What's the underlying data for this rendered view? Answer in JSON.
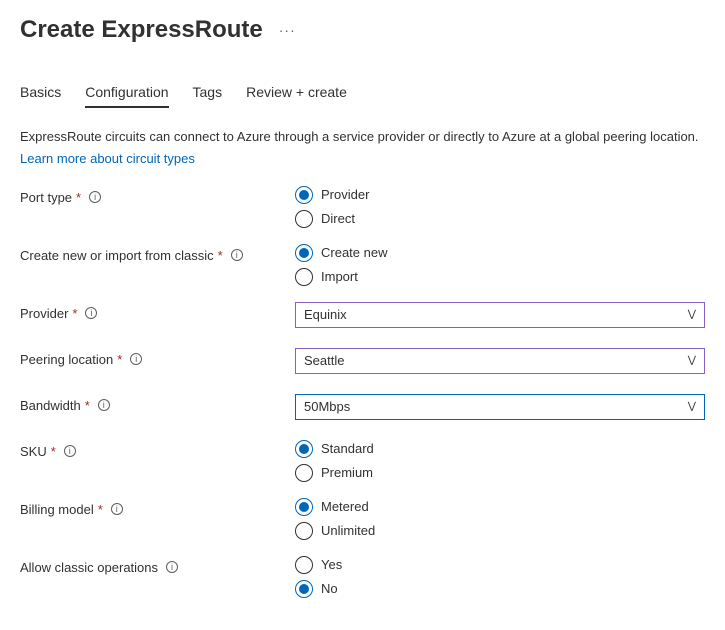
{
  "header": {
    "title": "Create ExpressRoute",
    "ellipsis": "···"
  },
  "tabs": {
    "items": [
      {
        "label": "Basics"
      },
      {
        "label": "Configuration"
      },
      {
        "label": "Tags"
      },
      {
        "label": "Review + create"
      }
    ],
    "activeIndex": 1
  },
  "intro": {
    "text": "ExpressRoute circuits can connect to Azure through a service provider or directly to Azure at a global peering location.",
    "link": "Learn more about circuit types"
  },
  "fields": {
    "portType": {
      "label": "Port type",
      "options": [
        "Provider",
        "Direct"
      ],
      "selected": "Provider"
    },
    "createOrImport": {
      "label": "Create new or import from classic",
      "options": [
        "Create new",
        "Import"
      ],
      "selected": "Create new"
    },
    "provider": {
      "label": "Provider",
      "value": "Equinix"
    },
    "peeringLocation": {
      "label": "Peering location",
      "value": "Seattle"
    },
    "bandwidth": {
      "label": "Bandwidth",
      "value": "50Mbps"
    },
    "sku": {
      "label": "SKU",
      "options": [
        "Standard",
        "Premium"
      ],
      "selected": "Standard"
    },
    "billingModel": {
      "label": "Billing model",
      "options": [
        "Metered",
        "Unlimited"
      ],
      "selected": "Metered"
    },
    "allowClassic": {
      "label": "Allow classic operations",
      "options": [
        "Yes",
        "No"
      ],
      "selected": "No"
    }
  }
}
